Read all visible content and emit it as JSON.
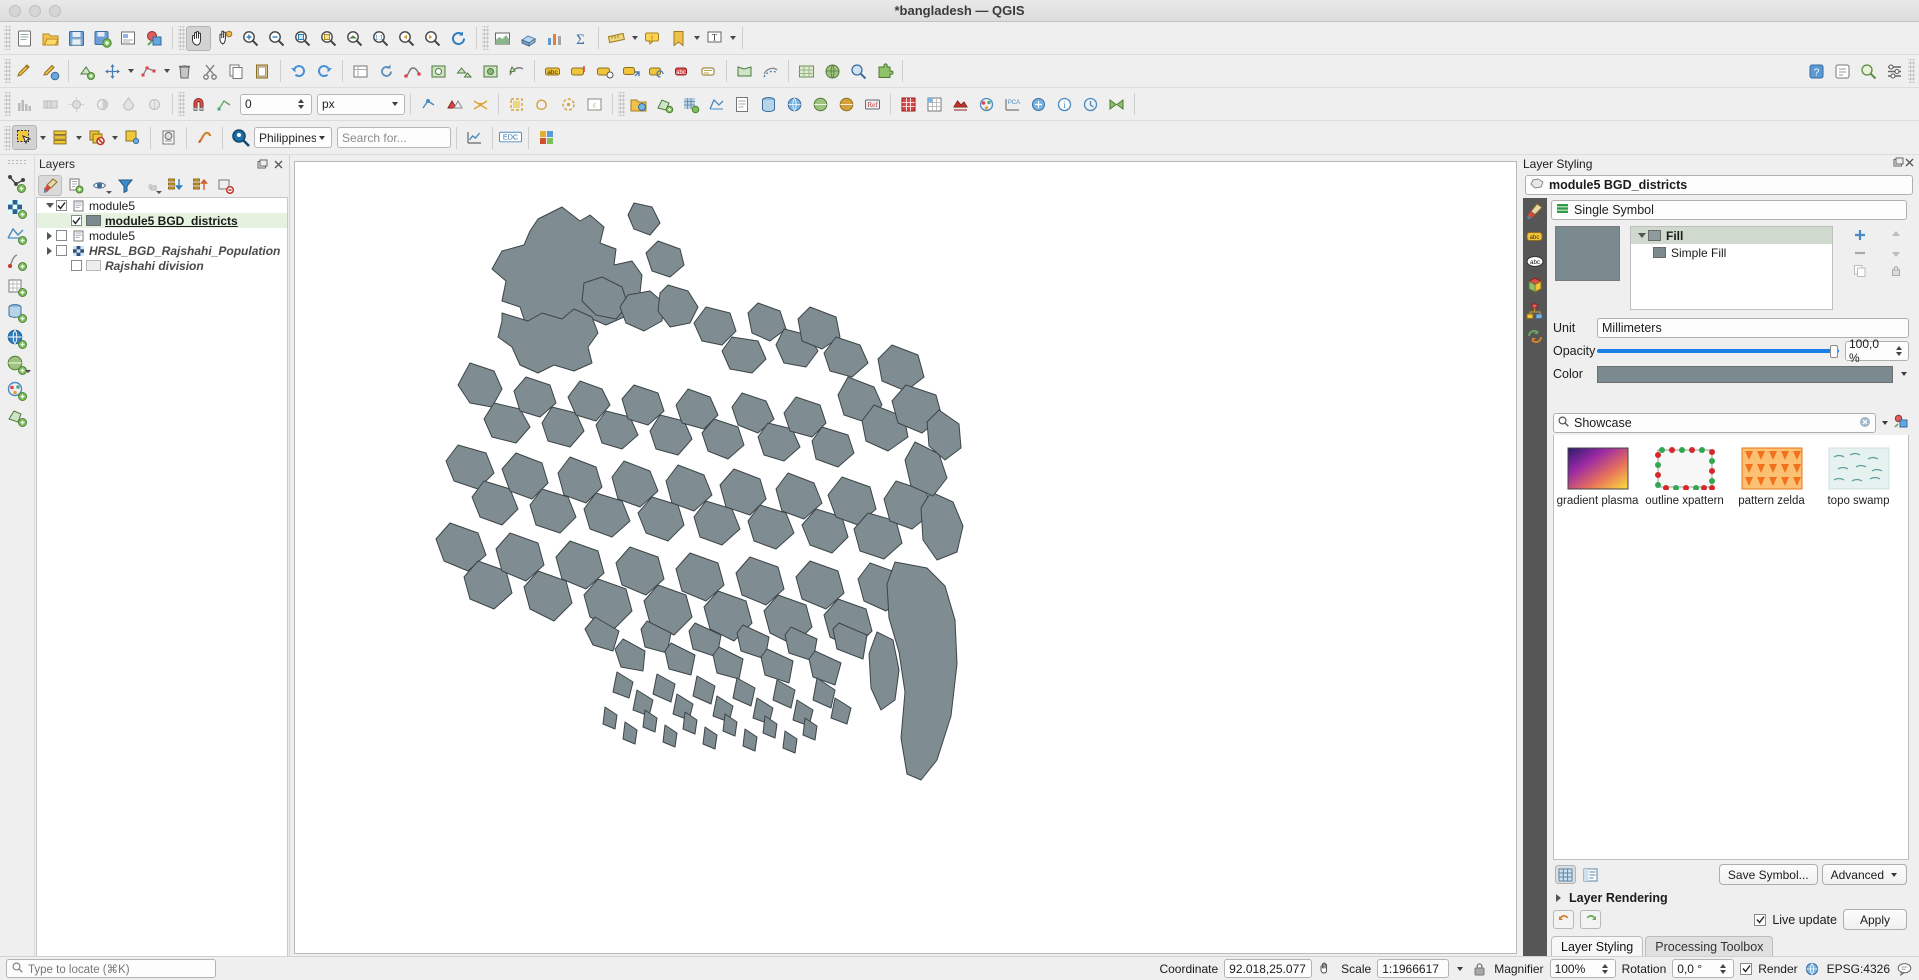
{
  "window": {
    "title": "*bangladesh — QGIS"
  },
  "layers_panel": {
    "title": "Layers",
    "toolbar": [
      {
        "name": "open-layer-styling-panel",
        "icon": "paintbrush-icon",
        "active": true
      },
      {
        "name": "add-group",
        "icon": "add-group-icon",
        "active": false
      },
      {
        "name": "manage-layer-visibility",
        "icon": "eye-icon",
        "active": false
      },
      {
        "name": "filter-legend",
        "icon": "funnel-icon",
        "active": false
      },
      {
        "name": "filter-legend-expression",
        "icon": "epsilon-icon",
        "active": false
      },
      {
        "name": "expand-all",
        "icon": "expand-down-icon",
        "active": false
      },
      {
        "name": "collapse-all",
        "icon": "collapse-up-icon",
        "active": false
      },
      {
        "name": "remove-layer",
        "icon": "remove-layer-icon",
        "active": false
      }
    ],
    "items": [
      {
        "label": "module5",
        "indent": 0,
        "expander": "down",
        "checked": true,
        "icon": "group-icon",
        "style": "plain"
      },
      {
        "label": "module5 BGD_districts",
        "indent": 1,
        "expander": "none",
        "checked": true,
        "icon": "polygon-swatch",
        "style": "bold",
        "selected": true,
        "swatch": "#7b8a8f"
      },
      {
        "label": "module5",
        "indent": 0,
        "expander": "right",
        "checked": false,
        "icon": "group-icon",
        "style": "plain"
      },
      {
        "label": "HRSL_BGD_Rajshahi_Population",
        "indent": 0,
        "expander": "right",
        "checked": false,
        "icon": "raster-icon",
        "style": "italic"
      },
      {
        "label": "Rajshahi division",
        "indent": 1,
        "expander": "none",
        "checked": false,
        "icon": "empty-swatch",
        "style": "italic",
        "swatch": "#eeeeee"
      }
    ]
  },
  "toolbars": {
    "row1": [
      "new-project-icon",
      "open-project-icon",
      "save-project-icon",
      "save-project-as-icon",
      "new-print-layout-icon",
      "style-manager-icon",
      "pan-map-icon",
      "pan-to-selection-icon",
      "zoom-in-icon",
      "zoom-out-icon",
      "zoom-full-icon",
      "zoom-to-selection-icon",
      "zoom-to-layer-icon",
      "zoom-native-icon",
      "zoom-last-icon",
      "zoom-next-icon",
      "refresh-icon",
      "new-map-view-icon",
      "new-3d-map-view-icon",
      "show-statistical-summary-icon",
      "sum-icon",
      "measure-line-icon",
      "show-map-tips-icon",
      "show-bookmarks-icon",
      "text-annotation-icon",
      "identify-features-icon",
      "select-features-icon",
      "deselect-icon",
      "open-field-calculator-icon",
      "open-attribute-table-icon",
      "processing-toolbox-icon",
      "python-console-icon",
      "help-icon"
    ],
    "row2": [
      "toggle-editing-icon",
      "save-layer-edits-icon",
      "add-feature-icon",
      "move-feature-icon",
      "node-tool-icon",
      "delete-selected-icon",
      "cut-features-icon",
      "copy-features-icon",
      "paste-features-icon",
      "undo-icon",
      "redo-icon",
      "modify-attributes-icon",
      "rotate-feature-icon",
      "simplify-feature-icon",
      "add-ring-icon",
      "add-part-icon",
      "fill-ring-icon",
      "reshape-features-icon",
      "label-icon",
      "pin-labels-icon",
      "show-hide-labels-icon",
      "move-label-icon",
      "rotate-label-icon",
      "change-label-icon",
      "highlight-pinned-labels-icon",
      "measure-area-icon",
      "offset-curve-icon",
      "georeferencer-icon",
      "osm-download-icon",
      "metasearch-icon",
      "plugin-icon",
      "help-contents-icon",
      "api-docs-icon",
      "locator-search-icon",
      "options-icon"
    ],
    "row3": [
      "raster-histogram-icon",
      "raster-stretch-icon",
      "raster-brightness-icon",
      "raster-contrast-icon",
      "raster-saturation-icon",
      "raster-hue-icon",
      "magnet-snapping-icon",
      "vertex-snap-icon",
      "snapping-mode-icon",
      "topological-editing-icon",
      "avoid-overlap-icon",
      "intersection-snap-icon",
      "select-polygon-icon",
      "select-freehand-icon",
      "select-radius-icon",
      "select-expression-icon",
      "open-data-source-manager-icon",
      "add-vector-layer-icon",
      "add-raster-layer-icon",
      "add-mesh-layer-icon",
      "add-delimited-text-icon",
      "add-postgis-icon",
      "add-wms-icon",
      "add-wcs-icon",
      "add-wfs-icon",
      "ref-layer-icon",
      "add-db2-icon",
      "add-spatialite-icon",
      "add-oracle-icon",
      "add-virtual-layer-icon",
      "pca-icon",
      "data-source-manager-icon",
      "info-icon",
      "temporal-controller-icon",
      "bowtie-icon"
    ],
    "row4_select": "select-features-icon",
    "row4": [
      "select-by-location-icon",
      "deselect-all-icon",
      "invert-selection-icon",
      "new-virtual-layer-icon",
      "show-processing-icon"
    ],
    "row4_search_label": "Philippines",
    "row4_search_placeholder": "Search for...",
    "row4_trailing": [
      "statistics-icon",
      "edc-icon",
      "colorful-plugin-icon"
    ]
  },
  "edit_toolbar": {
    "offset_value": "0",
    "unit": "px"
  },
  "layer_styling": {
    "title": "Layer Styling",
    "layer_name": "module5 BGD_districts",
    "renderer": "Single Symbol",
    "side_icons": [
      "labels-icon",
      "masks-icon",
      "3d-view-icon",
      "diagrams-icon",
      "undo-redo-icon"
    ],
    "symbol_preview_color": "#7b8a8f",
    "tree": [
      {
        "label": "Fill",
        "depth": 0,
        "expander": "down",
        "swatch": "#8d9a9e",
        "selected": true
      },
      {
        "label": "Simple Fill",
        "depth": 1,
        "expander": "none",
        "swatch": "#7b8a8f",
        "selected": false
      }
    ],
    "tree_buttons": [
      "add-symbol-layer-icon",
      "up-arrow-icon",
      "remove-symbol-layer-icon",
      "down-arrow-icon",
      "duplicate-icon",
      "lock-icon"
    ],
    "properties": {
      "unit_label": "Unit",
      "unit_value": "Millimeters",
      "opacity_label": "Opacity",
      "opacity_value": "100,0 %",
      "color_label": "Color",
      "color_value": "#7b8a8f",
      "slider_color": "#1a7fe8"
    },
    "showcase": {
      "search_text": "Showcase",
      "items": [
        {
          "label": "gradient  plasma",
          "thumb": "gradient-plasma"
        },
        {
          "label": "outline xpattern",
          "thumb": "outline-xpattern"
        },
        {
          "label": "pattern zelda",
          "thumb": "pattern-zelda"
        },
        {
          "label": "topo swamp",
          "thumb": "topo-swamp"
        }
      ],
      "view_icons": [
        "grid-view-icon",
        "list-view-icon"
      ],
      "save_symbol_label": "Save Symbol...",
      "advanced_label": "Advanced"
    },
    "layer_rendering_label": "Layer Rendering",
    "footer": {
      "undo_icon": "undo-icon",
      "redo_icon": "redo-icon",
      "live_update_label": "Live update",
      "live_update_checked": true,
      "apply_label": "Apply"
    }
  },
  "tabs": [
    {
      "label": "Layer Styling",
      "active": true
    },
    {
      "label": "Processing Toolbox",
      "active": false
    }
  ],
  "status_bar": {
    "locate_placeholder": "Type to locate (⌘K)",
    "coordinate_label": "Coordinate",
    "coordinate_value": "92.018,25.077",
    "scale_label": "Scale",
    "scale_value": "1:1966617",
    "magnifier_label": "Magnifier",
    "magnifier_value": "100%",
    "rotation_label": "Rotation",
    "rotation_value": "0,0 °",
    "render_label": "Render",
    "render_checked": true,
    "crs_value": "EPSG:4326"
  },
  "map": {
    "background": "#ffffff",
    "fill": "#7f8c91",
    "stroke": "#3c4548"
  }
}
